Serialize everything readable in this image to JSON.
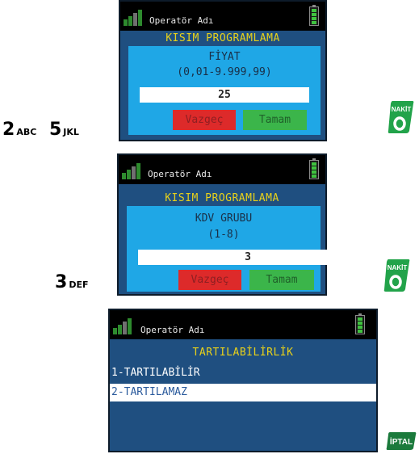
{
  "operator_label": "Operatör Adı",
  "screen1": {
    "title": "KISIM PROGRAMLAMA",
    "field_label": "FİYAT",
    "range": "(0,01-9.999,99)",
    "value": "25",
    "cancel": "Vazgeç",
    "ok": "Tamam"
  },
  "screen2": {
    "title": "KISIM PROGRAMLAMA",
    "field_label": "KDV GRUBU",
    "range": "(1-8)",
    "value": "3",
    "cancel": "Vazgeç",
    "ok": "Tamam"
  },
  "screen3": {
    "title": "TARTILABİLİRLİK",
    "items": [
      "1-TARTILABİLİR",
      "2-TARTILAMAZ"
    ],
    "selected_index": 1
  },
  "keys_row1": [
    {
      "digit": "2",
      "letters": "ABC"
    },
    {
      "digit": "5",
      "letters": "JKL"
    }
  ],
  "keys_row2": [
    {
      "digit": "3",
      "letters": "DEF"
    }
  ],
  "nakit_label": "NAKİT",
  "iptal_label": "İPTAL",
  "colors": {
    "screen_bg": "#1f4f80",
    "panel_bg": "#1fa7e6",
    "title_yellow": "#e8d11a",
    "cancel_red": "#dd2a2a",
    "ok_green": "#3bb54a",
    "key_green": "#22a34a"
  }
}
